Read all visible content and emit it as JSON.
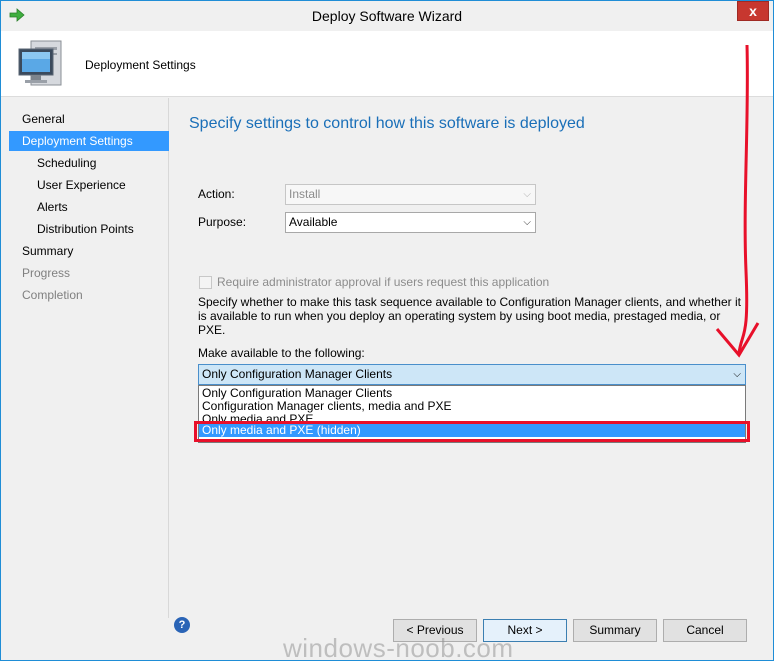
{
  "window": {
    "title": "Deploy Software Wizard",
    "close_glyph": "x"
  },
  "header": {
    "title": "Deployment Settings"
  },
  "nav": {
    "items": [
      {
        "label": "General",
        "state": "normal",
        "level": 0
      },
      {
        "label": "Deployment Settings",
        "state": "active",
        "level": 0
      },
      {
        "label": "Scheduling",
        "state": "normal",
        "level": 1
      },
      {
        "label": "User Experience",
        "state": "normal",
        "level": 1
      },
      {
        "label": "Alerts",
        "state": "normal",
        "level": 1
      },
      {
        "label": "Distribution Points",
        "state": "normal",
        "level": 1
      },
      {
        "label": "Summary",
        "state": "normal",
        "level": 0
      },
      {
        "label": "Progress",
        "state": "disabled",
        "level": 0
      },
      {
        "label": "Completion",
        "state": "disabled",
        "level": 0
      }
    ]
  },
  "content": {
    "heading": "Specify settings to control how this software is deployed",
    "action": {
      "label": "Action:",
      "value": "Install"
    },
    "purpose": {
      "label": "Purpose:",
      "value": "Available"
    },
    "approval_checkbox": {
      "label": "Require administrator approval if users request this application",
      "checked": false,
      "enabled": false
    },
    "description": "Specify whether to make this task sequence available to Configuration Manager clients, and whether it is available to run when you deploy an operating system by using boot media, prestaged media, or PXE.",
    "make_available": {
      "label": "Make available to the following:",
      "value": "Only Configuration Manager Clients",
      "options": [
        "Only Configuration Manager Clients",
        "Configuration Manager clients, media and PXE",
        "Only media and PXE",
        "Only media and PXE (hidden)"
      ],
      "highlighted_option": "Only media and PXE (hidden)"
    }
  },
  "footer": {
    "help_glyph": "?",
    "previous_label": "< Previous",
    "next_label": "Next >",
    "summary_label": "Summary",
    "cancel_label": "Cancel"
  },
  "watermark": "windows-noob.com",
  "colors": {
    "accent": "#3399ff",
    "heading": "#1a6fb8",
    "annotation": "#e8102a"
  }
}
